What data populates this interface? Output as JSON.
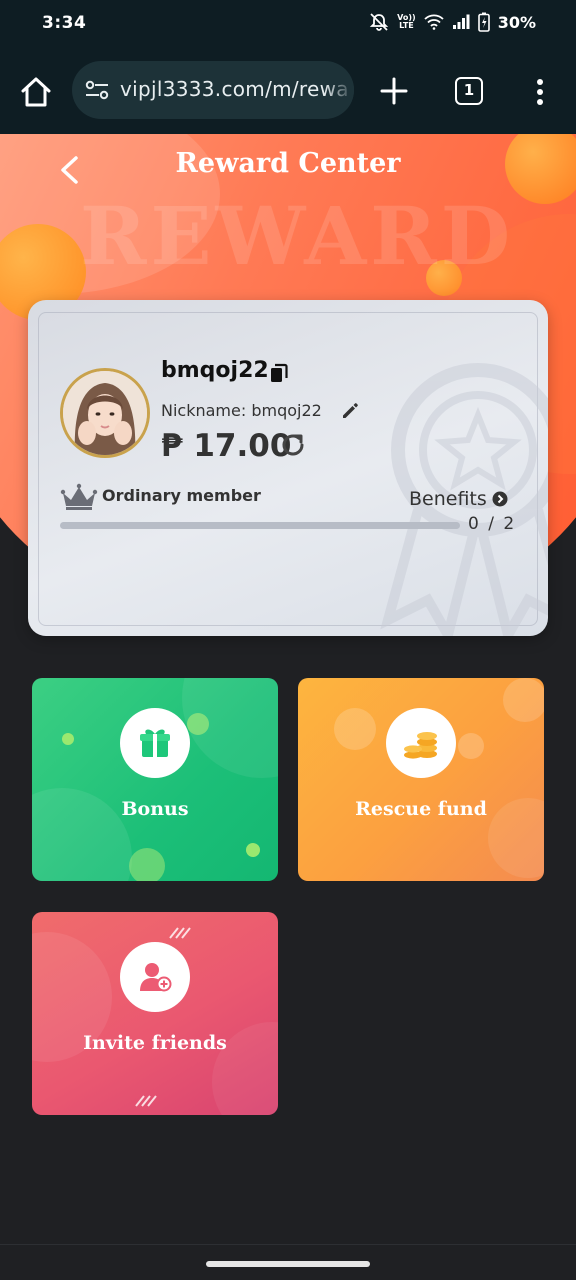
{
  "status_bar": {
    "time": "3:34",
    "lte_top": "Vo))",
    "lte_bottom": "LTE",
    "battery": "30%"
  },
  "browser": {
    "url": "vipjl3333.com/m/rewa",
    "tab_count": "1"
  },
  "page": {
    "title": "Reward Center",
    "watermark": "REWARD"
  },
  "member_card": {
    "username": "bmqoj22",
    "nickname": "Nickname: bmqoj22",
    "balance": "₱ 17.00",
    "level": "Ordinary member",
    "benefits_label": "Benefits",
    "progress_text": "0 / 2",
    "progress_fraction": 0
  },
  "tiles": [
    {
      "label": "Bonus",
      "icon": "gift-icon"
    },
    {
      "label": "Rescue fund",
      "icon": "coins-icon"
    },
    {
      "label": "Invite friends",
      "icon": "invite-user-icon"
    }
  ],
  "colors": {
    "hero_orange": "#ff6a3d",
    "bonus_green": "#1cbf78",
    "rescue_orange": "#fca040",
    "invite_pink": "#ea5870",
    "background": "#1f2023"
  }
}
